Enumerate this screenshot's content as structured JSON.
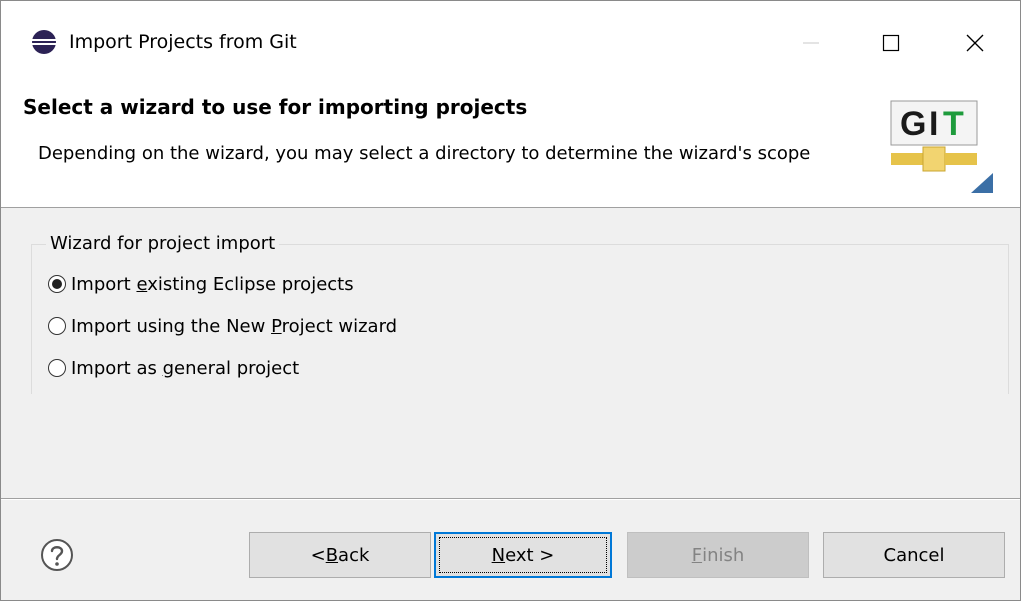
{
  "window": {
    "title": "Import Projects from Git",
    "icon": "eclipse-icon"
  },
  "header": {
    "title": "Select a wizard to use for importing projects",
    "description": "Depending on the wizard, you may select a directory to determine the wizard's scope",
    "logo": {
      "letters": [
        "G",
        "I",
        "T"
      ],
      "icon": "git-logo-icon"
    }
  },
  "group": {
    "legend": "Wizard for project import",
    "options": [
      {
        "pre": "Import ",
        "mnemonic": "e",
        "post": "xisting Eclipse projects",
        "checked": true
      },
      {
        "pre": "Import using the New ",
        "mnemonic": "P",
        "post": "roject wizard",
        "checked": false
      },
      {
        "pre": "Import as ",
        "mnemonic": "g",
        "post": "eneral project",
        "checked": false
      }
    ]
  },
  "buttons": {
    "back": {
      "pre": "< ",
      "mnemonic": "B",
      "post": "ack"
    },
    "next": {
      "pre": "",
      "mnemonic": "N",
      "post": "ext >"
    },
    "finish": {
      "pre": "",
      "mnemonic": "F",
      "post": "inish",
      "enabled": false
    },
    "cancel": {
      "label": "Cancel"
    }
  },
  "colors": {
    "accent": "#0078d7",
    "git_green": "#1e9b3c",
    "git_gold": "#e6c34a"
  }
}
